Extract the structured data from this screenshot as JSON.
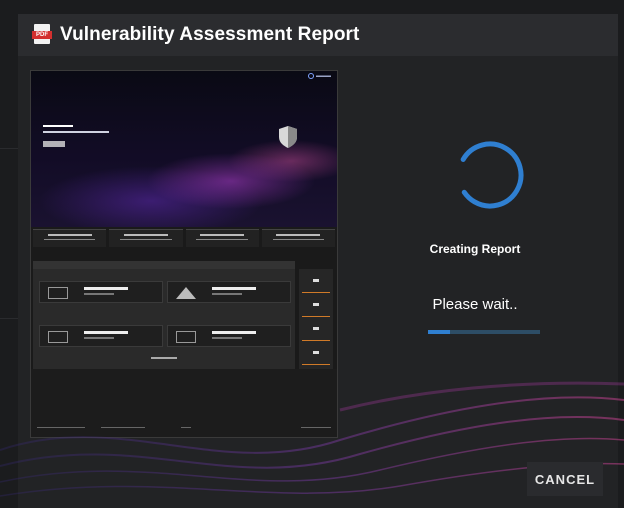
{
  "dialog": {
    "title": "Vulnerability Assessment Report",
    "icon": "pdf-icon"
  },
  "preview": {
    "thumbnail": "report-preview-thumbnail"
  },
  "status": {
    "message": "Creating Report",
    "sub_message": "Please wait..",
    "progress": 0.2
  },
  "actions": {
    "cancel_label": "CANCEL"
  },
  "colors": {
    "accent": "#2f7fd1",
    "progress_track": "#2d4d66",
    "pdf_red": "#d3302f"
  }
}
